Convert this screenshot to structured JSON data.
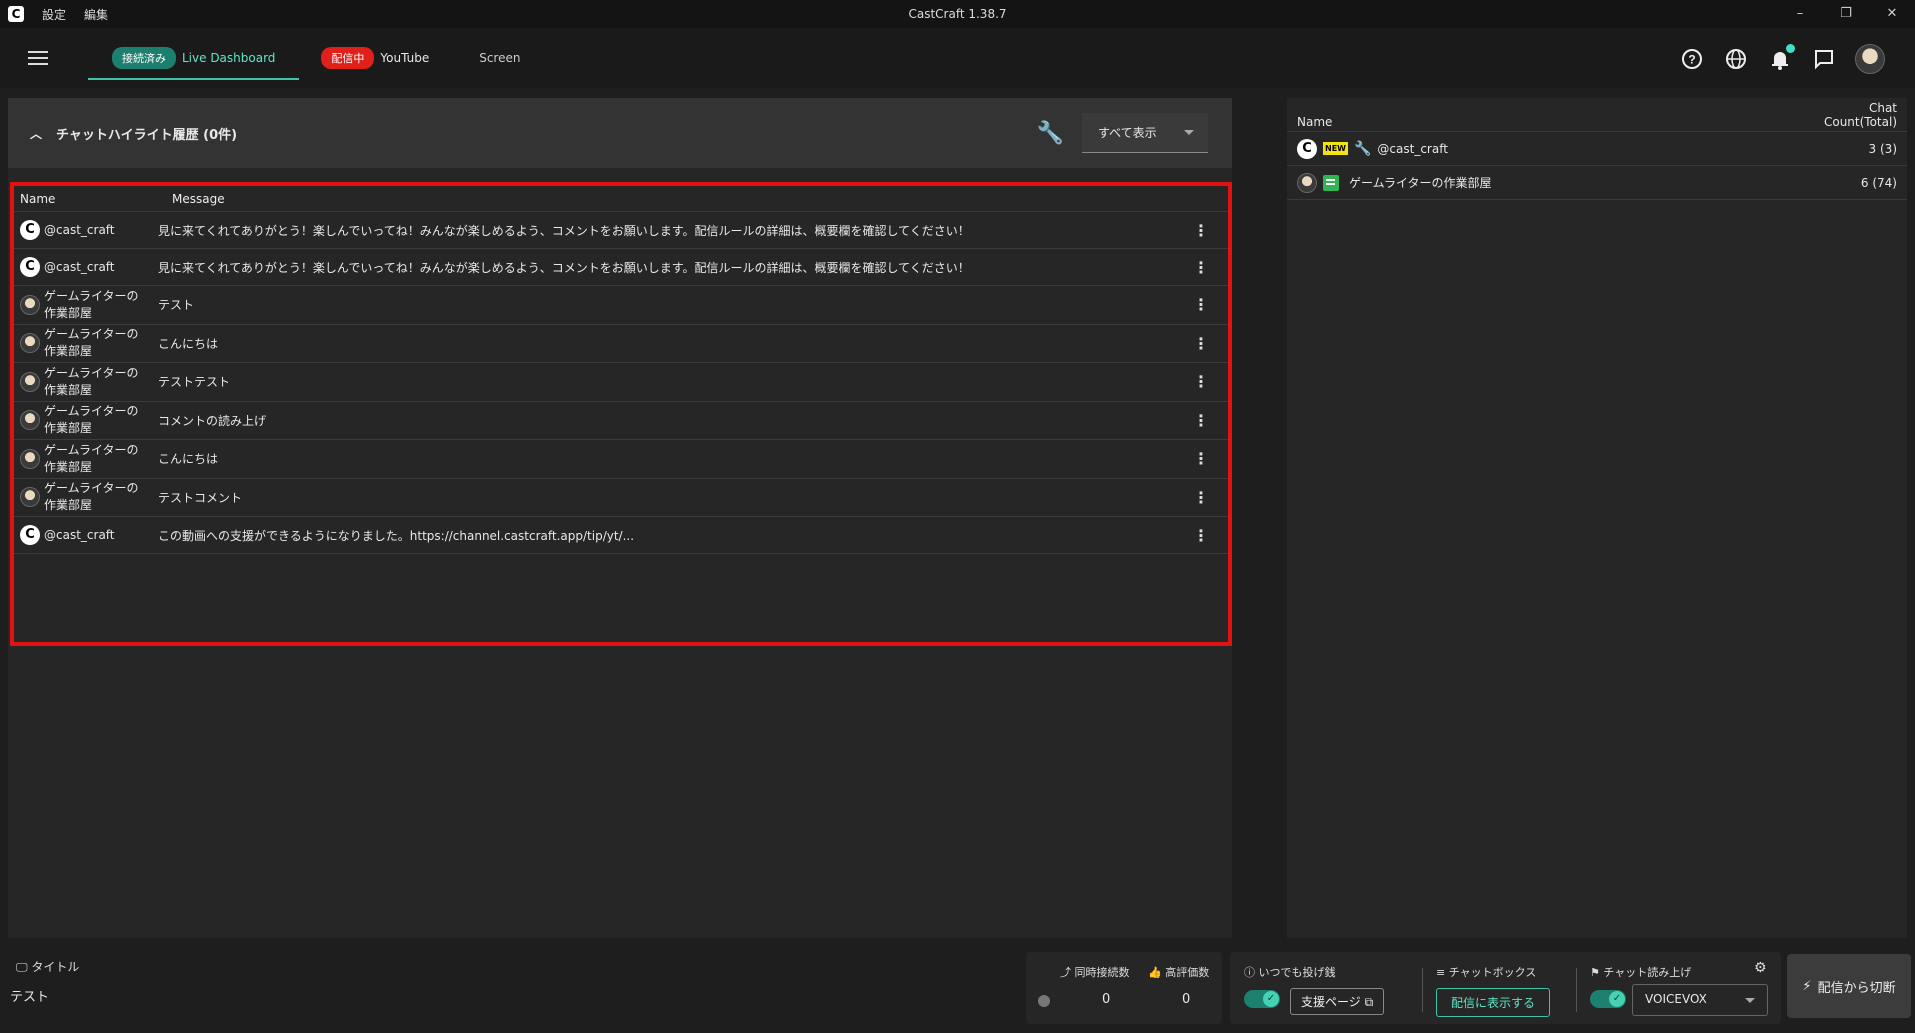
{
  "titlebar": {
    "menu": [
      "設定",
      "編集"
    ],
    "title": "CastCraft 1.38.7",
    "controls": [
      "–",
      "❐",
      "✕"
    ]
  },
  "nav": {
    "tabs": [
      {
        "badge": "接続済み",
        "label": "Live Dashboard"
      },
      {
        "badge": "配信中",
        "label": "YouTube"
      },
      {
        "label": "Screen"
      }
    ]
  },
  "highlight": {
    "title": "チャットハイライト履歴 (0件)",
    "filter": "すべて表示"
  },
  "chat_table": {
    "col_name": "Name",
    "col_message": "Message",
    "rows": [
      {
        "user": "@cast_craft",
        "message": "見に来てくれてありがとう！楽しんでいってね！みんなが楽しめるよう、コメントをお願いします。配信ルールの詳細は、概要欄を確認してください！",
        "avatar": "castcraft-icon"
      },
      {
        "user": "@cast_craft",
        "message": "見に来てくれてありがとう！楽しんでいってね！みんなが楽しめるよう、コメントをお願いします。配信ルールの詳細は、概要欄を確認してください！",
        "avatar": "castcraft-icon"
      },
      {
        "user1": "ゲームライターの",
        "user2": "作業部屋",
        "message": "テスト",
        "avatar": "user-avatar"
      },
      {
        "user1": "ゲームライターの",
        "user2": "作業部屋",
        "message": "こんにちは",
        "avatar": "user-avatar"
      },
      {
        "user1": "ゲームライターの",
        "user2": "作業部屋",
        "message": "テストテスト",
        "avatar": "user-avatar"
      },
      {
        "user1": "ゲームライターの",
        "user2": "作業部屋",
        "message": "コメントの読み上げ",
        "avatar": "user-avatar"
      },
      {
        "user1": "ゲームライターの",
        "user2": "作業部屋",
        "message": "こんにちは",
        "avatar": "user-avatar"
      },
      {
        "user1": "ゲームライターの",
        "user2": "作業部屋",
        "message": "テストコメント",
        "avatar": "user-avatar"
      },
      {
        "user": "@cast_craft",
        "message": "この動画への支援ができるようになりました。https://channel.castcraft.app/tip/yt/...",
        "avatar": "castcraft-icon"
      }
    ]
  },
  "viewers": {
    "col_name": "Name",
    "col_count_1": "Chat",
    "col_count_2": "Count(Total)",
    "rows": [
      {
        "name": "@cast_craft",
        "badge": "NEW",
        "count": "3 (3)"
      },
      {
        "name": "ゲームライターの作業部屋",
        "count": "6 (74)"
      }
    ]
  },
  "bottom": {
    "title_label": "タイトル",
    "title_value": "テスト",
    "concurrent_label": "同時接続数",
    "likes_label": "高評価数",
    "concurrent_value": "0",
    "likes_value": "0",
    "tip_label": "いつでも投げ銭",
    "tip_button": "支援ページ",
    "chatbox_label": "チャットボックス",
    "chatbox_button": "配信に表示する",
    "tts_label": "チャット読み上げ",
    "tts_voice": "VOICEVOX",
    "disconnect": "配信から切断"
  },
  "colors": {
    "accent": "#40c4a8",
    "live_red": "#e0201b",
    "highlight_border": "#e31111"
  }
}
